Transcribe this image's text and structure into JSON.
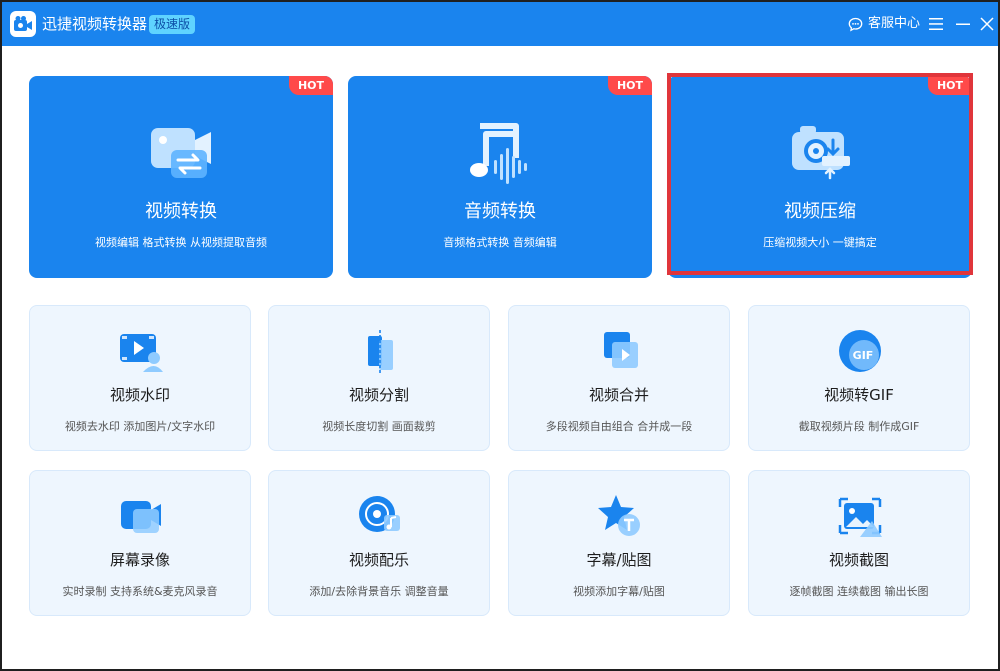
{
  "app": {
    "title": "迅捷视频转换器",
    "edition": "极速版"
  },
  "titlebar": {
    "service_label": "客服中心",
    "menu_icon": "hamburger-menu-icon",
    "minimize_icon": "minimize-icon",
    "close_icon": "close-icon"
  },
  "colors": {
    "titlebar": "#1a84ee",
    "card_primary": "#1a84ee",
    "hot_badge": "#ff4a4a",
    "highlight_frame": "#e0353b",
    "small_card_bg": "#eef6fe"
  },
  "main_cards": [
    {
      "title": "视频转换",
      "desc": "视频编辑 格式转换 从视频提取音频",
      "badge": "HOT",
      "icon": "video-convert-icon"
    },
    {
      "title": "音频转换",
      "desc": "音频格式转换 音频编辑",
      "badge": "HOT",
      "icon": "audio-convert-icon"
    },
    {
      "title": "视频压缩",
      "desc": "压缩视频大小 一键搞定",
      "badge": "HOT",
      "icon": "video-compress-icon",
      "highlighted": true
    }
  ],
  "tools": [
    {
      "title": "视频水印",
      "desc": "视频去水印 添加图片/文字水印",
      "icon": "video-watermark-icon"
    },
    {
      "title": "视频分割",
      "desc": "视频长度切割 画面裁剪",
      "icon": "video-split-icon"
    },
    {
      "title": "视频合并",
      "desc": "多段视频自由组合 合并成一段",
      "icon": "video-merge-icon"
    },
    {
      "title": "视频转GIF",
      "desc": "截取视频片段 制作成GIF",
      "icon": "gif-icon"
    },
    {
      "title": "屏幕录像",
      "desc": "实时录制 支持系统&麦克风录音",
      "icon": "screen-record-icon"
    },
    {
      "title": "视频配乐",
      "desc": "添加/去除背景音乐 调整音量",
      "icon": "background-music-icon"
    },
    {
      "title": "字幕/贴图",
      "desc": "视频添加字幕/贴图",
      "icon": "subtitle-sticker-icon"
    },
    {
      "title": "视频截图",
      "desc": "逐帧截图 连续截图 输出长图",
      "icon": "screenshot-icon"
    }
  ]
}
